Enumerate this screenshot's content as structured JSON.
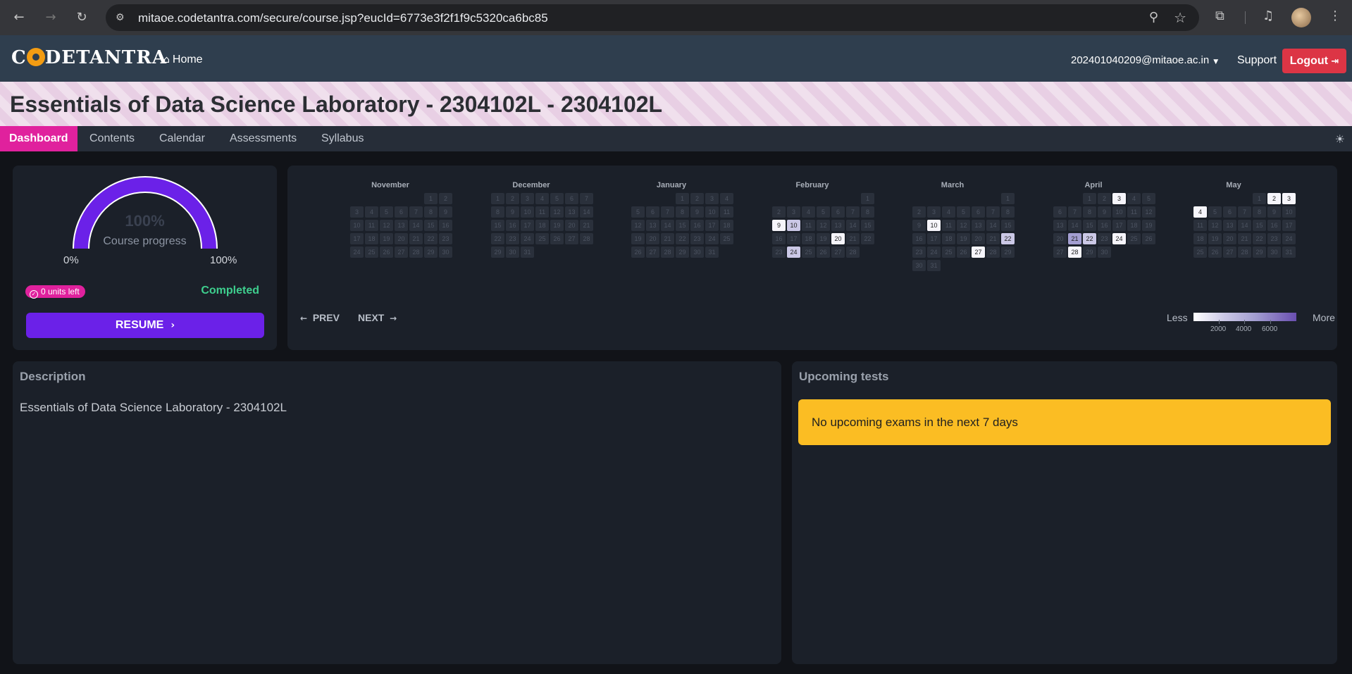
{
  "browser": {
    "url": "mitaoe.codetantra.com/secure/course.jsp?eucId=6773e3f2f1f9c5320ca6bc85",
    "icons": [
      "back-icon",
      "forward-icon",
      "reload-icon",
      "site-info-icon",
      "zoom-icon",
      "bookmark-star-icon",
      "extensions-icon",
      "media-icon",
      "profile-avatar",
      "menu-dots-icon"
    ]
  },
  "header": {
    "logo_prefix": "C",
    "logo_rest": "DETANTRA",
    "home": "Home",
    "user": "202401040209@mitaoe.ac.in",
    "support": "Support",
    "logout": "Logout"
  },
  "course": {
    "title": "Essentials of Data Science Laboratory - 2304102L - 2304102L"
  },
  "tabs": [
    "Dashboard",
    "Contents",
    "Calendar",
    "Assessments",
    "Syllabus"
  ],
  "progress": {
    "percent_text": "100%",
    "value": 1.0,
    "label": "Course progress",
    "min_label": "0%",
    "max_label": "100%",
    "units_left": "0 units left",
    "status": "Completed",
    "resume": "RESUME",
    "color": "#6b21e8"
  },
  "calendar": {
    "prev": "PREV",
    "next": "NEXT",
    "legend_less": "Less",
    "legend_more": "More",
    "legend_ticks": [
      "2000",
      "4000",
      "6000"
    ],
    "months": [
      {
        "name": "November",
        "start": 5,
        "days": 30,
        "active": {}
      },
      {
        "name": "December",
        "start": 0,
        "days": 31,
        "active": {}
      },
      {
        "name": "January",
        "start": 3,
        "days": 31,
        "active": {}
      },
      {
        "name": "February",
        "start": 6,
        "days": 28,
        "active": {
          "9": 1,
          "10": 2,
          "20": 1,
          "24": 2
        }
      },
      {
        "name": "March",
        "start": 6,
        "days": 31,
        "active": {
          "10": 1,
          "22": 2,
          "27": 1
        }
      },
      {
        "name": "April",
        "start": 2,
        "days": 30,
        "active": {
          "3": 1,
          "21": 3,
          "22": 2,
          "24": 1,
          "28": 1
        }
      },
      {
        "name": "May",
        "start": 4,
        "days": 31,
        "active": {
          "2": 1,
          "3": 1,
          "4": 1
        }
      }
    ]
  },
  "description": {
    "heading": "Description",
    "text": "Essentials of Data Science Laboratory - 2304102L"
  },
  "upcoming": {
    "heading": "Upcoming tests",
    "message": "No upcoming exams in the next 7 days"
  }
}
